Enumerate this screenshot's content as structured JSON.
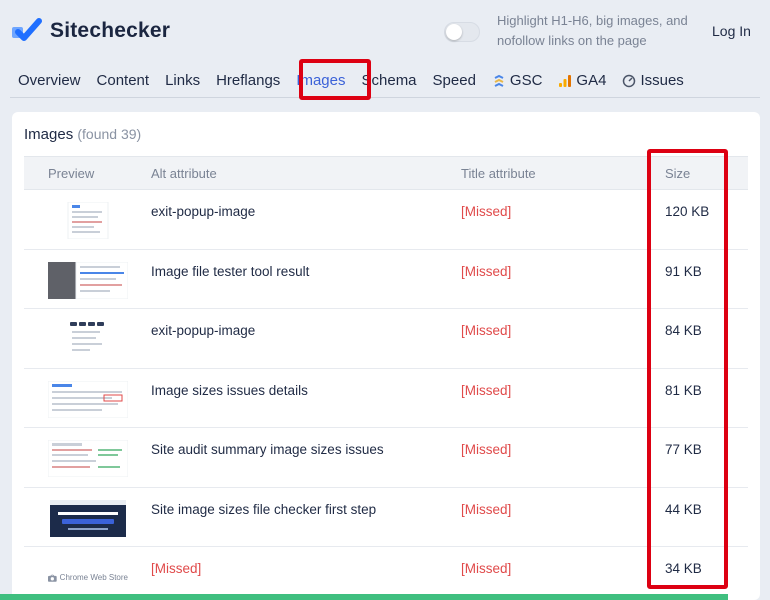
{
  "brand": {
    "name": "Sitechecker",
    "accent": "#3b62d8",
    "mark_color": "#1f6fff"
  },
  "header": {
    "toggle_label": "Highlight H1-H6, big images, and nofollow links on the page",
    "login": "Log In"
  },
  "nav": {
    "items": [
      {
        "label": "Overview"
      },
      {
        "label": "Content"
      },
      {
        "label": "Links"
      },
      {
        "label": "Hreflangs"
      },
      {
        "label": "Images"
      },
      {
        "label": "Schema"
      },
      {
        "label": "Speed"
      },
      {
        "label": "GSC",
        "icon": "gsc-icon"
      },
      {
        "label": "GA4",
        "icon": "ga4-icon"
      },
      {
        "label": "Issues",
        "icon": "gauge-icon"
      }
    ],
    "active": "Images"
  },
  "images_panel": {
    "title": "Images",
    "found": "(found 39)",
    "columns": {
      "preview": "Preview",
      "alt": "Alt attribute",
      "title": "Title attribute",
      "size": "Size"
    },
    "rows": [
      {
        "alt": "exit-popup-image",
        "title": "[Missed]",
        "size": "120 KB",
        "preview": "popup-preview"
      },
      {
        "alt": "Image file tester tool result",
        "title": "[Missed]",
        "size": "91 KB",
        "preview": "tester-preview"
      },
      {
        "alt": "exit-popup-image",
        "title": "[Missed]",
        "size": "84 KB",
        "preview": "popup-preview-2"
      },
      {
        "alt": "Image sizes issues details",
        "title": "[Missed]",
        "size": "81 KB",
        "preview": "issues-preview"
      },
      {
        "alt": "Site audit summary image sizes issues",
        "title": "[Missed]",
        "size": "77 KB",
        "preview": "audit-preview"
      },
      {
        "alt": "Site image sizes file checker first step",
        "title": "[Missed]",
        "size": "44 KB",
        "preview": "checker-preview"
      },
      {
        "alt": "[Missed]",
        "title": "[Missed]",
        "size": "34 KB",
        "preview": "chrome-web-store-logo",
        "preview_text": "Chrome Web Store"
      }
    ]
  },
  "colors": {
    "missed": "#e04a4a",
    "highlight": "#dd0012",
    "progress": "#3fbf7f"
  }
}
